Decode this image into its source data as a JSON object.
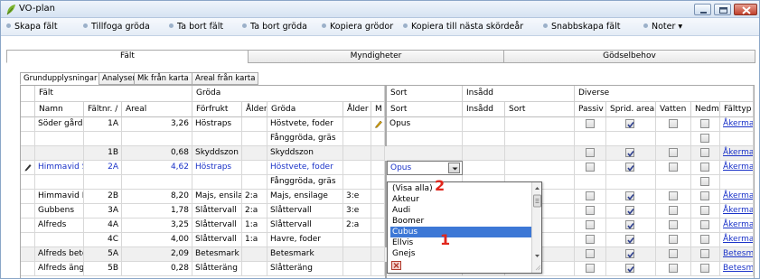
{
  "window": {
    "title": "VO-plan",
    "brand_color": "#7ab32e"
  },
  "toolbar": {
    "items": [
      "Skapa fält",
      "Tillfoga gröda",
      "Ta bort fält",
      "Ta bort gröda",
      "Kopiera grödor",
      "Kopiera till nästa skördeår",
      "Snabbskapa fält",
      "Noter ▾"
    ]
  },
  "main_tabs": [
    "Fält",
    "Myndigheter",
    "Gödselbehov"
  ],
  "sub_tabs": [
    "Grundupplysningar",
    "Analyser",
    "Mk från karta",
    "Areal från karta"
  ],
  "grid": {
    "groups": {
      "falt": "Fält",
      "groda": "Gröda",
      "sort": "Sort",
      "insadd": "Insådd",
      "diverse": "Diverse"
    },
    "headers": {
      "namn": "Namn",
      "faltnr": "Fältnr. /",
      "areal": "Areal",
      "forfrukt": "Förfrukt",
      "alder1": "Ålder",
      "groda": "Gröda",
      "alder2": "Ålder",
      "m": "M",
      "sort": "Sort",
      "insadd": "Insådd",
      "sort2": "Sort",
      "passiv": "Passiv",
      "sprid_areal": "Sprid. areal",
      "vatten": "Vatten",
      "nedm": "Nedm.",
      "falttyp": "Fälttyp"
    },
    "rows": [
      {
        "namn": "Söder gård",
        "faltnr": "1A",
        "areal": "3,26",
        "forfrukt": "Höstraps",
        "alder1": "",
        "groda": "Höstvete, foder",
        "alder2": "",
        "sort": "Opus",
        "falttyp": "Åkermark"
      },
      {
        "namn": "",
        "faltnr": "",
        "areal": "",
        "forfrukt": "",
        "alder1": "",
        "groda": "Fånggröda, gräs",
        "alder2": "",
        "sort": "",
        "falttyp": ""
      },
      {
        "namn": "",
        "faltnr": "1B",
        "areal": "0,68",
        "forfrukt": "Skyddszon",
        "alder1": "",
        "groda": "Skyddszon",
        "alder2": "",
        "sort": "",
        "falttyp": "Åkermark"
      },
      {
        "namn": "Himmavid S",
        "faltnr": "2A",
        "areal": "4,62",
        "forfrukt": "Höstraps",
        "alder1": "",
        "groda": "Höstvete, foder",
        "alder2": "",
        "sort": "Opus",
        "falttyp": "Åkermark"
      },
      {
        "namn": "",
        "faltnr": "",
        "areal": "",
        "forfrukt": "",
        "alder1": "",
        "groda": "Fånggröda, gräs",
        "alder2": "",
        "sort": "",
        "falttyp": ""
      },
      {
        "namn": "Himmavid N",
        "faltnr": "2B",
        "areal": "8,20",
        "forfrukt": "Majs, ensilage",
        "alder1": "2:a",
        "groda": "Majs, ensilage",
        "alder2": "3:e",
        "sort": "",
        "falttyp": "Åkermark"
      },
      {
        "namn": "Gubbens",
        "faltnr": "3A",
        "areal": "1,78",
        "forfrukt": "Slåttervall",
        "alder1": "2:a",
        "groda": "Slåttervall",
        "alder2": "3:e",
        "sort": "",
        "falttyp": "Åkermark"
      },
      {
        "namn": "Alfreds",
        "faltnr": "4A",
        "areal": "3,25",
        "forfrukt": "Slåttervall",
        "alder1": "1:a",
        "groda": "Slåttervall",
        "alder2": "2:a",
        "sort": "",
        "falttyp": "Åkermark"
      },
      {
        "namn": "",
        "faltnr": "4C",
        "areal": "4,00",
        "forfrukt": "Slåttervall",
        "alder1": "1:a",
        "groda": "Havre, foder",
        "alder2": "",
        "sort": "",
        "falttyp": "Åkermark"
      },
      {
        "namn": "Alfreds bete",
        "faltnr": "5A",
        "areal": "2,09",
        "forfrukt": "Betesmark",
        "alder1": "",
        "groda": "Betesmark",
        "alder2": "",
        "sort": "",
        "falttyp": "Betesmark"
      },
      {
        "namn": "Alfreds äng",
        "faltnr": "5B",
        "areal": "0,28",
        "forfrukt": "Slåtteräng",
        "alder1": "",
        "groda": "Slåtteräng",
        "alder2": "",
        "sort": "",
        "falttyp": "Betesmark"
      }
    ],
    "active_sort_value": "Opus"
  },
  "dropdown": {
    "options": [
      "(Visa alla)",
      "Akteur",
      "Audi",
      "Boomer",
      "Cubus",
      "Ellvis",
      "Gnejs"
    ],
    "highlighted": "Cubus"
  },
  "annotations": {
    "one": "1",
    "two": "2"
  },
  "colors": {
    "selection": "#3d78d6",
    "edited_row_text": "#1a32c8",
    "annotation": "#e1261c"
  }
}
